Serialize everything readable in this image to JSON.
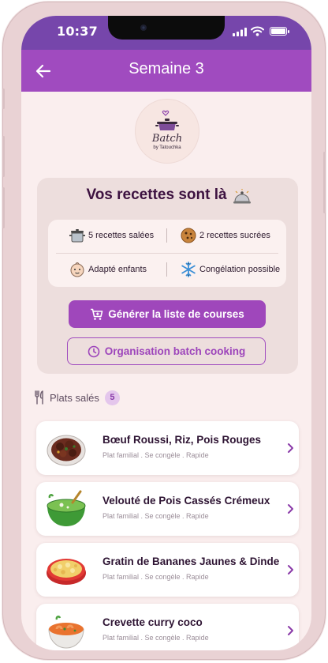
{
  "status": {
    "time": "10:37"
  },
  "appbar": {
    "title": "Semaine 3"
  },
  "logo": {
    "brand": "Batch",
    "byline": "by Tatouchka"
  },
  "summary": {
    "heading": "Vos recettes sont là",
    "features": [
      {
        "icon": "pot-icon",
        "label": "5 recettes salées"
      },
      {
        "icon": "cookie-icon",
        "label": "2 recettes sucrées"
      },
      {
        "icon": "baby-face-icon",
        "label": "Adapté enfants"
      },
      {
        "icon": "snowflake-icon",
        "label": "Congélation possible"
      }
    ],
    "generate_label": "Générer la liste de courses",
    "organize_label": "Organisation batch cooking"
  },
  "section": {
    "label": "Plats salés",
    "count": "5"
  },
  "recipes": [
    {
      "name": "Bœuf Roussi, Riz, Pois Rouges",
      "meta": "Plat familial . Se congèle . Rapide",
      "image": "beef-stew"
    },
    {
      "name": "Velouté de Pois Cassés Crémeux",
      "meta": "Plat familial . Se congèle . Rapide",
      "image": "green-soup"
    },
    {
      "name": "Gratin de Bananes Jaunes & Dinde",
      "meta": "Plat familial . Se congèle . Rapide",
      "image": "gratin"
    },
    {
      "name": "Crevette curry coco",
      "meta": "Plat familial . Se congèle . Rapide",
      "image": "curry-bowl"
    }
  ],
  "colors": {
    "status_bar": "#7646ab",
    "app_bar": "#a04bbf",
    "background": "#faeeee",
    "accent": "#9f47bb",
    "heading_text": "#3d1240"
  }
}
